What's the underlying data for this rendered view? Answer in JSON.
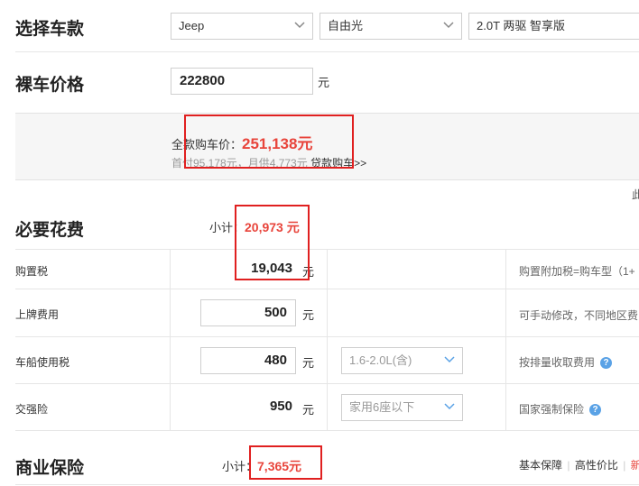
{
  "car_select": {
    "title": "选择车款",
    "brand": "Jeep",
    "model": "自由光",
    "trim": "2.0T 两驱 智享版"
  },
  "bare_price": {
    "title": "裸车价格",
    "value": "222800",
    "unit": "元"
  },
  "total": {
    "label": "全款购车价：",
    "value": "251,138元",
    "loan_text": "首付95,178元，月供4,773元",
    "loan_link": "贷款购车>>",
    "edge_text": "此"
  },
  "required": {
    "title": "必要花费",
    "subtotal_label": "小计：",
    "subtotal_value": "20,973 元",
    "rows": [
      {
        "label": "购置税",
        "value": "19,043",
        "unit": "元",
        "note": "购置附加税=购车型（1+"
      },
      {
        "label": "上牌费用",
        "value": "500",
        "unit": "元",
        "note": "可手动修改，不同地区费"
      },
      {
        "label": "车船使用税",
        "value": "480",
        "unit": "元",
        "option": "1.6-2.0L(含)",
        "note": "按排量收取费用"
      },
      {
        "label": "交强险",
        "value": "950",
        "unit": "元",
        "option": "家用6座以下",
        "note": "国家强制保险"
      }
    ]
  },
  "commercial": {
    "title": "商业保险",
    "subtotal_label": "小计：",
    "subtotal_value": "7,365元",
    "links": [
      "基本保障",
      "高性价比",
      "新车"
    ]
  },
  "help_icon_symbol": "?",
  "colors": {
    "accent_red": "#e8443b",
    "box_red": "#e02020",
    "help_blue": "#5aa2e6"
  }
}
